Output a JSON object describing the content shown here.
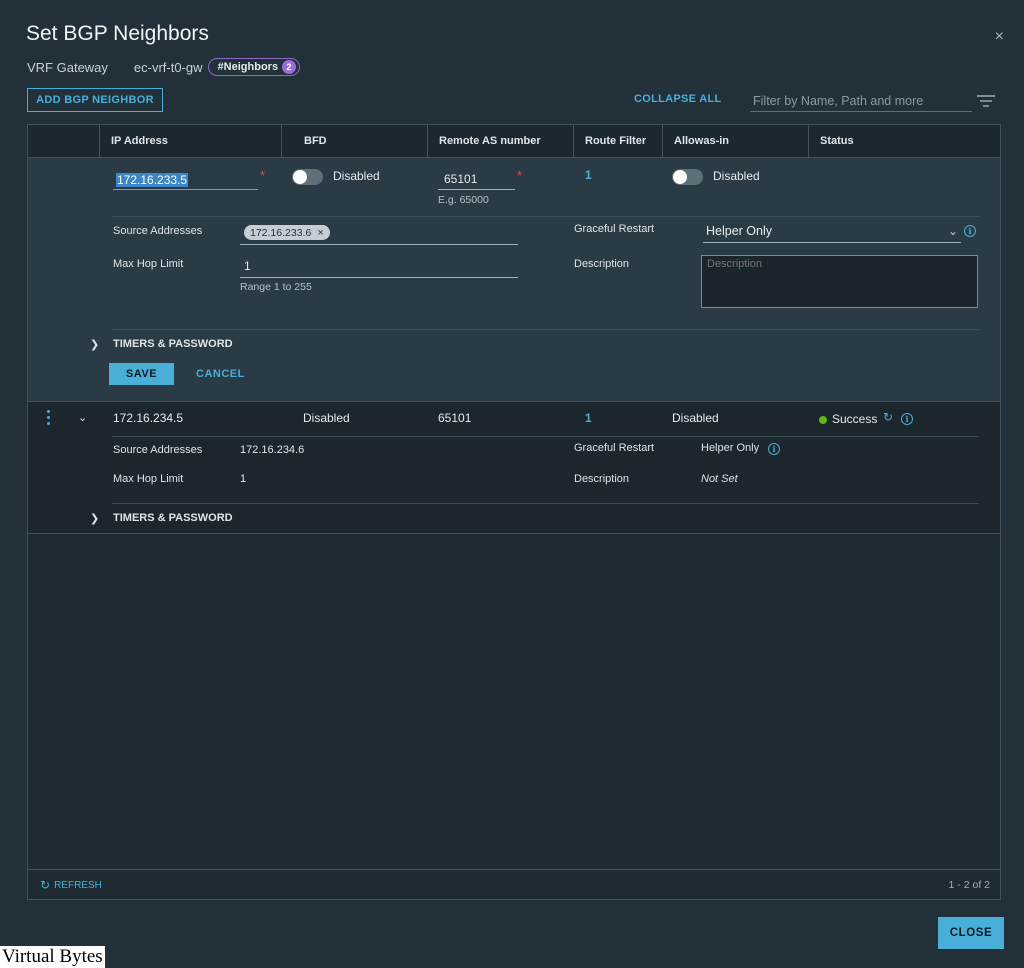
{
  "dialog": {
    "title": "Set BGP Neighbors",
    "close_glyph": "×",
    "gateway_type": "VRF Gateway",
    "gateway_name": "ec-vrf-t0-gw",
    "neighbors_badge": "#Neighbors",
    "neighbors_count": "2"
  },
  "toolbar": {
    "add_label": "ADD BGP NEIGHBOR",
    "collapse_all_label": "COLLAPSE ALL",
    "filter_placeholder": "Filter by Name, Path and more"
  },
  "columns": [
    "IP Address",
    "BFD",
    "Remote AS number",
    "Route Filter",
    "Allowas-in",
    "Status"
  ],
  "edit_row": {
    "ip_address": "172.16.233.5",
    "required_mark": "*",
    "bfd_label": "Disabled",
    "bfd_enabled": false,
    "remote_as": "65101",
    "remote_as_hint": "E.g. 65000",
    "route_filter": "1",
    "allowas_in_label": "Disabled",
    "allowas_in_enabled": false,
    "source_addresses_label": "Source Addresses",
    "source_address_chip": "172.16.233.6",
    "chip_remove_glyph": "×",
    "max_hop_label": "Max Hop Limit",
    "max_hop_value": "1",
    "max_hop_hint": "Range 1 to 255",
    "graceful_restart_label": "Graceful Restart",
    "graceful_restart_value": "Helper Only",
    "description_label": "Description",
    "description_placeholder": "Description",
    "timers_label": "TIMERS & PASSWORD",
    "save_label": "SAVE",
    "cancel_label": "CANCEL"
  },
  "view_row": {
    "ip_address": "172.16.234.5",
    "bfd": "Disabled",
    "remote_as": "65101",
    "route_filter": "1",
    "allowas_in": "Disabled",
    "status": "Success",
    "status_color": "#5eb715",
    "source_addresses_label": "Source Addresses",
    "source_addresses": "172.16.234.6",
    "max_hop_label": "Max Hop Limit",
    "max_hop_value": "1",
    "graceful_restart_label": "Graceful Restart",
    "graceful_restart_value": "Helper Only",
    "description_label": "Description",
    "description_value": "Not Set",
    "timers_label": "TIMERS & PASSWORD"
  },
  "footer": {
    "refresh_label": "REFRESH",
    "pagination": "1 - 2 of 2",
    "close_label": "CLOSE"
  },
  "watermark": "Virtual Bytes",
  "colors": {
    "accent": "#49afd9",
    "background": "#223039",
    "required": "#e14c4c",
    "badge": "#9b6dd6"
  }
}
